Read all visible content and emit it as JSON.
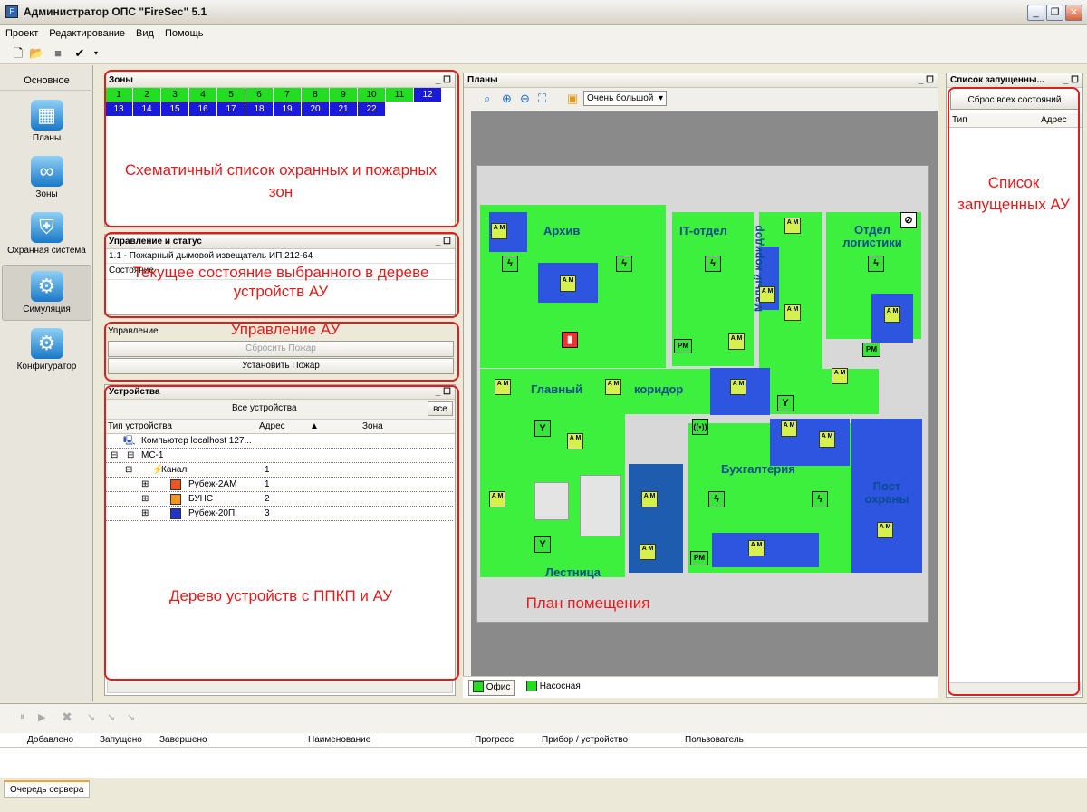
{
  "app": {
    "title": "Администратор ОПС \"FireSec\" 5.1"
  },
  "menu": [
    "Проект",
    "Редактирование",
    "Вид",
    "Помощь"
  ],
  "nav": {
    "header": "Основное",
    "items": [
      "Планы",
      "Зоны",
      "Охранная система",
      "Симуляция",
      "Конфигуратор"
    ]
  },
  "zones": {
    "title": "Зоны",
    "row1": [
      "1",
      "2",
      "3",
      "4",
      "5",
      "6",
      "7",
      "8",
      "9",
      "10",
      "11",
      "12"
    ],
    "row2": [
      "13",
      "14",
      "15",
      "16",
      "17",
      "18",
      "19",
      "20",
      "21",
      "22"
    ],
    "annotation": "Схематичный список охранных и пожарных зон"
  },
  "control": {
    "title": "Управление и статус",
    "device": "1.1 - Пожарный дымовой извещатель ИП 212-64",
    "state_label": "Состояние",
    "annotation": "Текущее состояние выбранного в дереве устройств АУ"
  },
  "manage": {
    "label": "Управление",
    "annotation": "Управление АУ",
    "reset_btn": "Сбросить Пожар",
    "set_btn": "Установить Пожар"
  },
  "devices": {
    "title": "Устройства",
    "filter": "Все устройства",
    "all_btn": "все",
    "col_type": "Тип устройства",
    "col_addr": "Адрес",
    "col_zone": "Зона",
    "annotation": "Дерево устройств с ППКП и АУ",
    "rows": [
      {
        "name": "Компьютер localhost 127...",
        "addr": ""
      },
      {
        "name": "МС-1",
        "addr": ""
      },
      {
        "name": "Канал",
        "addr": "1"
      },
      {
        "name": "Рубеж-2АМ",
        "addr": "1"
      },
      {
        "name": "БУНС",
        "addr": "2"
      },
      {
        "name": "Рубеж-20П",
        "addr": "3"
      }
    ]
  },
  "plans": {
    "title": "Планы",
    "zoom": "Очень большой",
    "annotation": "План помещения",
    "tabs": [
      "Офис",
      "Насосная"
    ],
    "rooms": [
      "Архив",
      "IT-отдел",
      "Отдел логистики",
      "Малый коридор",
      "Главный",
      "коридор",
      "Бухгалтерия",
      "Пост охраны",
      "Лестница"
    ]
  },
  "launched": {
    "title": "Список запущенны...",
    "reset_btn": "Сброс всех состояний",
    "col_type": "Тип",
    "col_addr": "Адрес",
    "annotation": "Список запущенных АУ"
  },
  "queue": {
    "cols": [
      "Добавлено",
      "Запущено",
      "Завершено",
      "Наименование",
      "Прогресс",
      "Прибор / устройство",
      "Пользователь"
    ],
    "tab": "Очередь сервера"
  },
  "colors": {
    "zone_green": "#22dd22",
    "zone_blue": "#1a1adc",
    "annotation_red": "#e21b1b",
    "room_green": "#3ef03e"
  }
}
